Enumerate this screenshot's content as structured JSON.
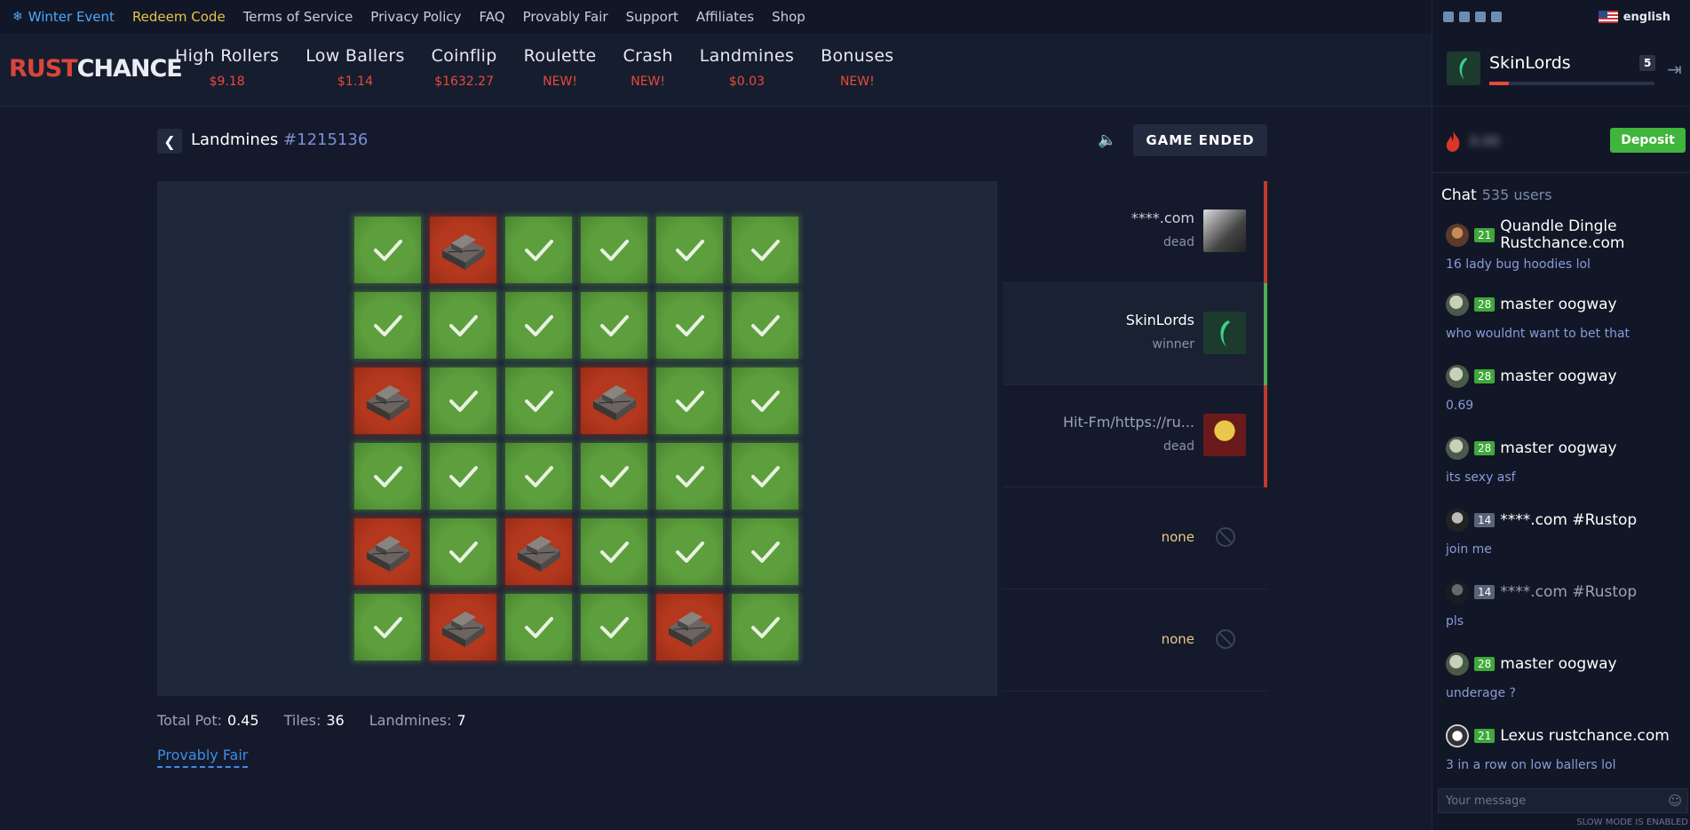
{
  "topbar": {
    "winter_event": "Winter Event",
    "redeem_code": "Redeem Code",
    "links": [
      "Terms of Service",
      "Privacy Policy",
      "FAQ",
      "Provably Fair",
      "Support",
      "Affiliates",
      "Shop"
    ]
  },
  "logo": {
    "part1": "RUST",
    "part2": "CHANCE"
  },
  "nav": [
    {
      "label": "High Rollers",
      "sub": "$9.18"
    },
    {
      "label": "Low Ballers",
      "sub": "$1.14"
    },
    {
      "label": "Coinflip",
      "sub": "$1632.27"
    },
    {
      "label": "Roulette",
      "sub": "NEW!"
    },
    {
      "label": "Crash",
      "sub": "NEW!"
    },
    {
      "label": "Landmines",
      "sub": "$0.03"
    },
    {
      "label": "Bonuses",
      "sub": "NEW!"
    }
  ],
  "language": "english",
  "user": {
    "name": "SkinLords",
    "level": "5",
    "balance_hidden": "0.00",
    "deposit_label": "Deposit",
    "xp_fraction": 0.12
  },
  "chat": {
    "title": "Chat",
    "users": "535 users",
    "placeholder": "Your message",
    "slow_mode": "SLOW MODE IS ENABLED",
    "messages": [
      {
        "level": "21",
        "name": "Quandle Dingle Rustchance.com",
        "text": "16 lady bug hoodies lol"
      },
      {
        "level": "28",
        "name": "master oogway",
        "text": "who wouldnt want to bet that"
      },
      {
        "level": "28",
        "name": "master oogway",
        "text": "0.69"
      },
      {
        "level": "28",
        "name": "master oogway",
        "text": "its sexy asf"
      },
      {
        "level": "14",
        "name": "****.com #Rustop",
        "text": "join me"
      },
      {
        "level": "14",
        "name": "****.com #Rustop",
        "text": "pls"
      },
      {
        "level": "28",
        "name": "master oogway",
        "text": "underage ?"
      },
      {
        "level": "21",
        "name": "Lexus rustchance.com",
        "text": "3 in a row on low ballers lol"
      }
    ]
  },
  "game": {
    "title": "Landmines",
    "id": "#1215136",
    "status": "GAME ENDED",
    "grid": [
      [
        "safe",
        "mine",
        "safe",
        "safe",
        "safe",
        "safe"
      ],
      [
        "safe",
        "safe",
        "safe",
        "safe",
        "safe",
        "safe"
      ],
      [
        "mine",
        "safe",
        "safe",
        "mine",
        "safe",
        "safe"
      ],
      [
        "safe",
        "safe",
        "safe",
        "safe",
        "safe",
        "safe"
      ],
      [
        "mine",
        "safe",
        "mine",
        "safe",
        "safe",
        "safe"
      ],
      [
        "safe",
        "mine",
        "safe",
        "safe",
        "mine",
        "safe"
      ]
    ],
    "players": [
      {
        "name": "****.com",
        "status": "dead"
      },
      {
        "name": "SkinLords",
        "status": "winner"
      },
      {
        "name": "Hit-Fm/https://ru...",
        "status": "dead"
      },
      {
        "name": "none",
        "status": ""
      },
      {
        "name": "none",
        "status": ""
      }
    ],
    "stats": {
      "total_pot_label": "Total Pot:",
      "total_pot": "0.45",
      "tiles_label": "Tiles:",
      "tiles": "36",
      "landmines_label": "Landmines:",
      "landmines": "7"
    },
    "provably_fair": "Provably Fair"
  },
  "colors": {
    "accent_red": "#e84a3a",
    "safe_green": "#5d9e3d",
    "mine_red": "#b3381e",
    "deposit_green": "#3fb53c",
    "link_blue": "#3f8be8"
  }
}
